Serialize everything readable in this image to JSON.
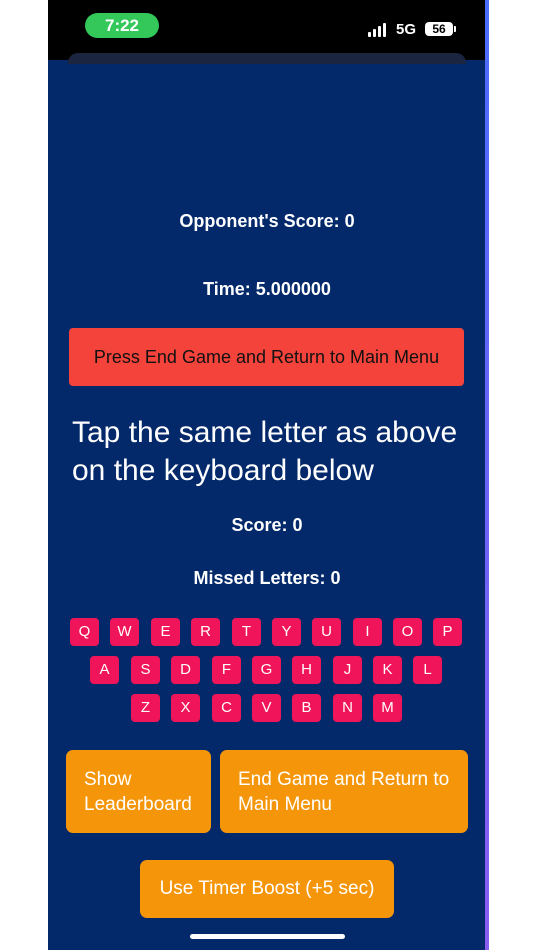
{
  "status_bar": {
    "time": "7:22",
    "network": "5G",
    "battery": "56"
  },
  "game": {
    "opponent_score": "Opponent's Score: 0",
    "time": "Time: 5.000000",
    "end_game_banner": "Press End Game and Return to Main Menu",
    "instruction": "Tap the same letter as above on the keyboard below",
    "score": "Score: 0",
    "missed_letters": "Missed Letters: 0"
  },
  "keyboard": {
    "row1": [
      "Q",
      "W",
      "E",
      "R",
      "T",
      "Y",
      "U",
      "I",
      "O",
      "P"
    ],
    "row2": [
      "A",
      "S",
      "D",
      "F",
      "G",
      "H",
      "J",
      "K",
      "L"
    ],
    "row3": [
      "Z",
      "X",
      "C",
      "V",
      "B",
      "N",
      "M"
    ]
  },
  "buttons": {
    "show_leaderboard": "Show Leaderboard",
    "end_game": "End Game and Return to Main Menu",
    "timer_boost": "Use Timer Boost (+5 sec)"
  },
  "colors": {
    "background": "#03296b",
    "key": "#f0145a",
    "banner": "#f4433a",
    "button": "#f5960a",
    "time_pill": "#34c759"
  }
}
